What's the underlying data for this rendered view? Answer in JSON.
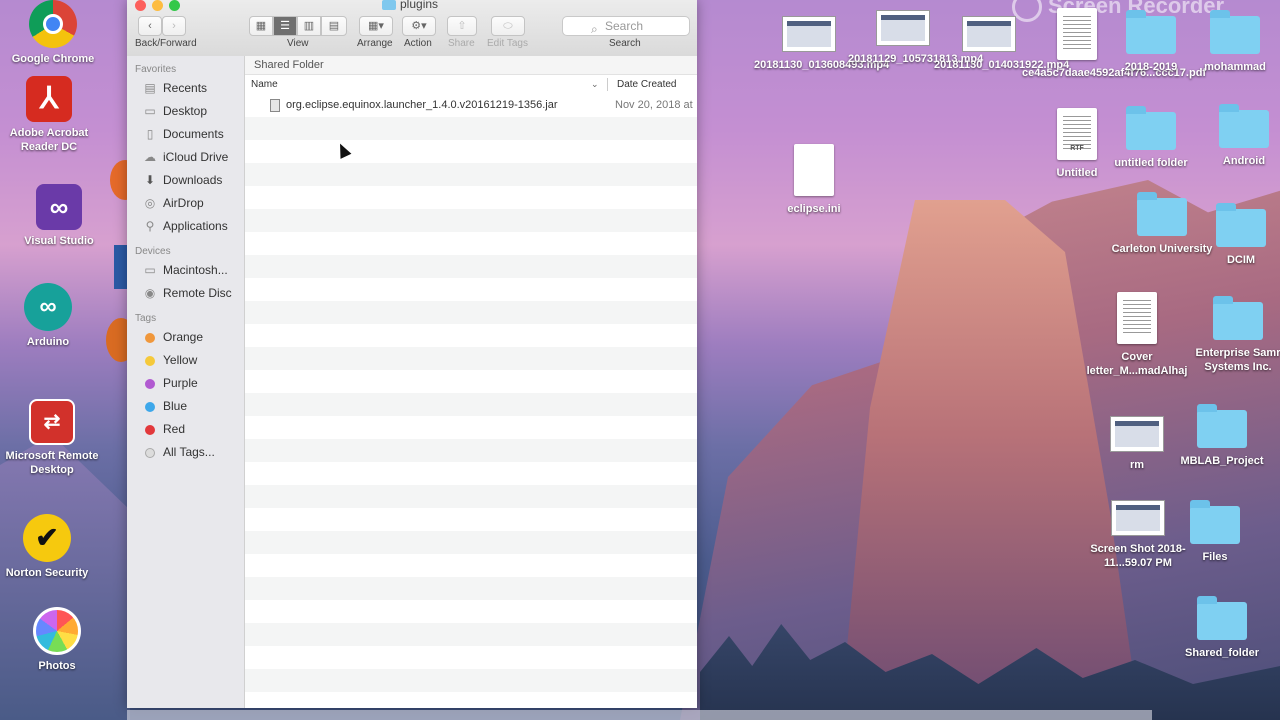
{
  "colors": {
    "accent": "#2f7bd8",
    "folder": "#7fd0f2",
    "sidebar_bg": "#e8e8ec"
  },
  "watermark": "Screen Recorder",
  "window": {
    "title": "plugins",
    "toolbar": {
      "back_forward": "Back/Forward",
      "view": "View",
      "arrange": "Arrange",
      "action": "Action",
      "share": "Share",
      "edit_tags": "Edit Tags",
      "search_label": "Search",
      "search_placeholder": "Search"
    },
    "sidebar": {
      "favorites_header": "Favorites",
      "favorites": [
        {
          "label": "Recents",
          "icon": "recents-icon"
        },
        {
          "label": "Desktop",
          "icon": "desktop-icon"
        },
        {
          "label": "Documents",
          "icon": "documents-icon"
        },
        {
          "label": "iCloud Drive",
          "icon": "cloud-icon"
        },
        {
          "label": "Downloads",
          "icon": "downloads-icon"
        },
        {
          "label": "AirDrop",
          "icon": "airdrop-icon"
        },
        {
          "label": "Applications",
          "icon": "applications-icon"
        }
      ],
      "devices_header": "Devices",
      "devices": [
        {
          "label": "Macintosh...",
          "icon": "harddisk-icon"
        },
        {
          "label": "Remote Disc",
          "icon": "disc-icon"
        }
      ],
      "tags_header": "Tags",
      "tags": [
        {
          "label": "Orange",
          "color": "#f0973b"
        },
        {
          "label": "Yellow",
          "color": "#f5c93a"
        },
        {
          "label": "Purple",
          "color": "#b15ad1"
        },
        {
          "label": "Blue",
          "color": "#3da7ea"
        },
        {
          "label": "Red",
          "color": "#e2383b"
        },
        {
          "label": "All Tags...",
          "color": "#dcdcdc"
        }
      ]
    },
    "content": {
      "breadcrumb": "Shared Folder",
      "col_name": "Name",
      "col_date": "Date Created",
      "files": [
        {
          "name": "org.eclipse.equinox.launcher_1.4.0.v20161219-1356.jar",
          "date": "Nov 20, 2018 at"
        }
      ]
    }
  },
  "desktop_left": [
    {
      "label": "Google Chrome"
    },
    {
      "label": "Adobe Acrobat Reader DC"
    },
    {
      "label": "Visual Studio"
    },
    {
      "label": "Arduino"
    },
    {
      "label": "Microsoft Remote Desktop"
    },
    {
      "label": "Norton Security"
    },
    {
      "label": "Photos"
    }
  ],
  "desktop_right": [
    {
      "label": "20181130_013608493.mp4"
    },
    {
      "label": "20181129_105731813.mp4"
    },
    {
      "label": "20181130_014031922.mp4"
    },
    {
      "label": "ce4a5c7daae4592af4f76...ccc17.pdf"
    },
    {
      "label": "2018-2019"
    },
    {
      "label": "mohammad"
    },
    {
      "label": "eclipse.ini"
    },
    {
      "label": "Untitled"
    },
    {
      "label": "untitled folder"
    },
    {
      "label": "Android"
    },
    {
      "label": "Carleton University"
    },
    {
      "label": "DCIM"
    },
    {
      "label": "Cover letter_M...madAlhaj"
    },
    {
      "label": "Enterprise Samr Systems Inc."
    },
    {
      "label": "rm"
    },
    {
      "label": "MBLAB_Project"
    },
    {
      "label": "Screen Shot 2018-11...59.07 PM"
    },
    {
      "label": "Files"
    },
    {
      "label": "Shared_folder"
    }
  ]
}
